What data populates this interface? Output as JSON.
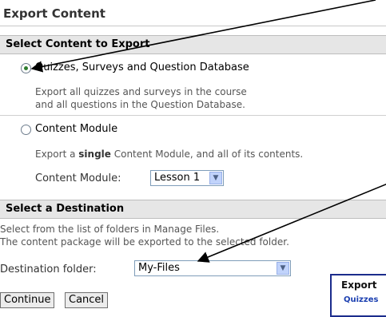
{
  "panel_title": "Export Content",
  "select_content": {
    "heading": "Select Content to Export",
    "option_quizzes": {
      "label": "Quizzes, Surveys and Question Database",
      "desc_line1": "Export all quizzes and surveys in the course",
      "desc_line2": "and all questions in the Question Database.",
      "checked": true
    },
    "option_module": {
      "label": "Content Module",
      "desc_prefix": "Export a ",
      "desc_bold": "single",
      "desc_suffix": " Content Module, and all of its contents.",
      "checked": false,
      "module_label": "Content Module:",
      "module_value": "Lesson 1"
    }
  },
  "destination": {
    "heading": "Select a Destination",
    "desc_line1": "Select from the list of folders in Manage Files.",
    "desc_line2": "The content package will be exported to the selected folder.",
    "folder_label": "Destination folder:",
    "folder_value": "My-Files"
  },
  "buttons": {
    "continue": "Continue",
    "cancel": "Cancel"
  },
  "inset": {
    "heading": "Export",
    "sub": "Quizzes"
  }
}
